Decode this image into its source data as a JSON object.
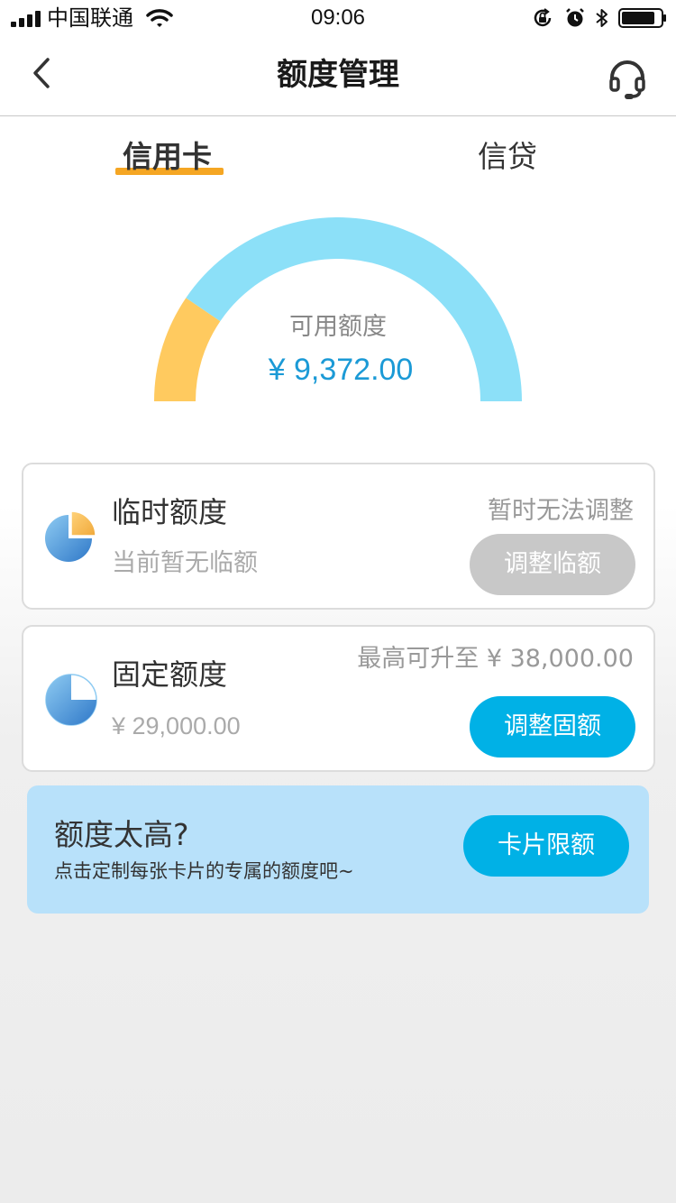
{
  "status_bar": {
    "carrier": "中国联通",
    "time": "09:06",
    "icons": [
      "signal-icon",
      "wifi-icon",
      "orientation-lock-icon",
      "alarm-icon",
      "bluetooth-icon",
      "battery-icon"
    ]
  },
  "nav": {
    "title": "额度管理",
    "back_icon": "chevron-left-icon",
    "service_icon": "headset-icon"
  },
  "tabs": [
    {
      "label": "信用卡",
      "active": true
    },
    {
      "label": "信贷",
      "active": false
    }
  ],
  "gauge": {
    "label": "可用额度",
    "amount": "¥ 9,372.00",
    "used_fraction": 0.19,
    "colors": {
      "used": "#ffca5f",
      "available": "#8ce0f8"
    }
  },
  "temp_limit": {
    "title": "临时额度",
    "subtitle": "当前暂无临额",
    "status": "暂时无法调整",
    "button": "调整临额",
    "icon": "pie-chart-icon"
  },
  "fixed_limit": {
    "title": "固定额度",
    "amount": "¥ 29,000.00",
    "max_text": "最高可升至 ¥  38,000.00",
    "button": "调整固额",
    "icon": "pie-chart-icon"
  },
  "promo": {
    "title": "额度太高?",
    "subtitle": "点击定制每张卡片的专属的额度吧~",
    "button": "卡片限额"
  },
  "colors": {
    "accent_blue": "#00b1e6",
    "tab_underline": "#f5a623",
    "amount_blue": "#1b9ad6",
    "promo_bg": "#b8e1fa"
  }
}
